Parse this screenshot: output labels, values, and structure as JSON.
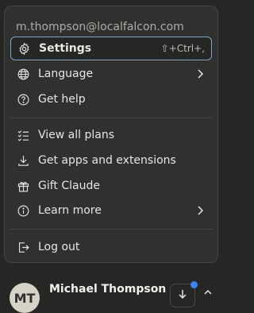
{
  "account": {
    "email": "m.thompson@localfalcon.com"
  },
  "menu": {
    "settings": {
      "label": "Settings",
      "shortcut": "⇧+Ctrl+,"
    },
    "language": {
      "label": "Language"
    },
    "help": {
      "label": "Get help"
    },
    "plans": {
      "label": "View all plans"
    },
    "apps": {
      "label": "Get apps and extensions"
    },
    "gift": {
      "label": "Gift Claude"
    },
    "learn": {
      "label": "Learn more"
    },
    "logout": {
      "label": "Log out"
    }
  },
  "user": {
    "initials": "MT",
    "name": "Michael Thompson"
  },
  "colors": {
    "accent": "#3b82f6",
    "active_border": "#7fa3d0"
  }
}
